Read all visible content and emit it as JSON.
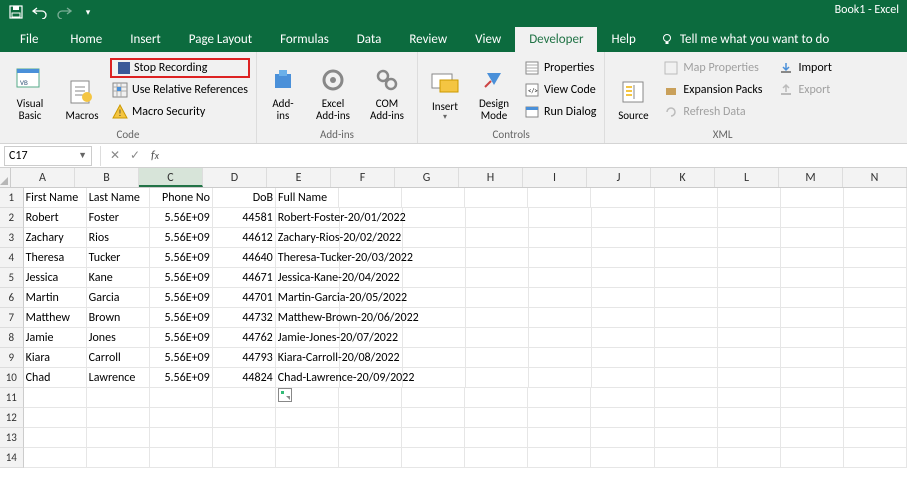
{
  "titlebar": {
    "title": "Book1  -  Excel"
  },
  "tabs": {
    "file": "File",
    "home": "Home",
    "insert": "Insert",
    "pageLayout": "Page Layout",
    "formulas": "Formulas",
    "data": "Data",
    "review": "Review",
    "view": "View",
    "developer": "Developer",
    "help": "Help",
    "tellMe": "Tell me what you want to do"
  },
  "ribbon": {
    "code": {
      "visualBasic": "Visual\nBasic",
      "macros": "Macros",
      "stopRecording": "Stop Recording",
      "useRelative": "Use Relative References",
      "macroSecurity": "Macro Security",
      "group": "Code"
    },
    "addins": {
      "addins": "Add-\nins",
      "excelAddins": "Excel\nAdd-ins",
      "comAddins": "COM\nAdd-ins",
      "group": "Add-ins"
    },
    "controls": {
      "insert": "Insert",
      "designMode": "Design\nMode",
      "properties": "Properties",
      "viewCode": "View Code",
      "runDialog": "Run Dialog",
      "group": "Controls"
    },
    "xml": {
      "source": "Source",
      "mapProperties": "Map Properties",
      "expansionPacks": "Expansion Packs",
      "refreshData": "Refresh Data",
      "import": "Import",
      "export": "Export",
      "group": "XML"
    }
  },
  "formulaBar": {
    "nameBox": "C17",
    "formula": ""
  },
  "sheet": {
    "columns": [
      "A",
      "B",
      "C",
      "D",
      "E",
      "F",
      "G",
      "H",
      "I",
      "J",
      "K",
      "L",
      "M",
      "N"
    ],
    "headers": {
      "A": "First Name",
      "B": "Last Name",
      "C": "Phone No",
      "D": "DoB",
      "E": "Full Name"
    },
    "rows": [
      {
        "A": "Robert",
        "B": "Foster",
        "C": "5.56E+09",
        "D": "44581",
        "E": "Robert-Foster-20/01/2022"
      },
      {
        "A": "Zachary",
        "B": "Rios",
        "C": "5.56E+09",
        "D": "44612",
        "E": "Zachary-Rios-20/02/2022"
      },
      {
        "A": "Theresa",
        "B": "Tucker",
        "C": "5.56E+09",
        "D": "44640",
        "E": "Theresa-Tucker-20/03/2022"
      },
      {
        "A": "Jessica",
        "B": "Kane",
        "C": "5.56E+09",
        "D": "44671",
        "E": "Jessica-Kane-20/04/2022"
      },
      {
        "A": "Martin",
        "B": "Garcia",
        "C": "5.56E+09",
        "D": "44701",
        "E": "Martin-Garcia-20/05/2022"
      },
      {
        "A": "Matthew",
        "B": "Brown",
        "C": "5.56E+09",
        "D": "44732",
        "E": "Matthew-Brown-20/06/2022"
      },
      {
        "A": "Jamie",
        "B": "Jones",
        "C": "5.56E+09",
        "D": "44762",
        "E": "Jamie-Jones-20/07/2022"
      },
      {
        "A": "Kiara",
        "B": "Carroll",
        "C": "5.56E+09",
        "D": "44793",
        "E": "Kiara-Carroll-20/08/2022"
      },
      {
        "A": "Chad",
        "B": "Lawrence",
        "C": "5.56E+09",
        "D": "44824",
        "E": "Chad-Lawrence-20/09/2022"
      }
    ]
  }
}
